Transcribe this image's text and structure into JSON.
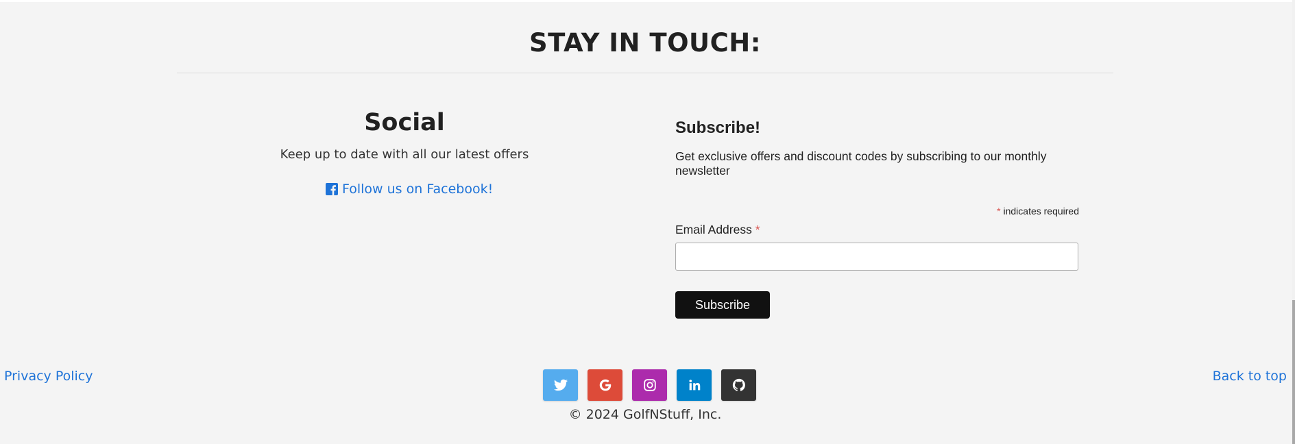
{
  "section": {
    "title": "STAY IN TOUCH:"
  },
  "social": {
    "title": "Social",
    "text": "Keep up to date with all our latest offers",
    "facebook_label": "Follow us on Facebook!"
  },
  "subscribe": {
    "title": "Subscribe!",
    "text": "Get exclusive offers and discount codes by subscribing to our monthly newsletter",
    "required_marker": "*",
    "required_note": "indicates required",
    "email_label": "Email Address",
    "email_value": "",
    "button_label": "Subscribe"
  },
  "footer": {
    "privacy_label": "Privacy Policy",
    "back_to_top_label": "Back to top",
    "copyright": "© 2024 GolfNStuff, Inc.",
    "social_icons": [
      {
        "name": "twitter-icon",
        "color": "#55acee"
      },
      {
        "name": "google-icon",
        "color": "#dd4b39"
      },
      {
        "name": "instagram-icon",
        "color": "#ac2bac"
      },
      {
        "name": "linkedin-icon",
        "color": "#0082ca"
      },
      {
        "name": "github-icon",
        "color": "#333333"
      }
    ]
  },
  "colors": {
    "link": "#1e73d8",
    "background": "#f4f4f4",
    "button": "#111111",
    "required": "#d9534f"
  }
}
